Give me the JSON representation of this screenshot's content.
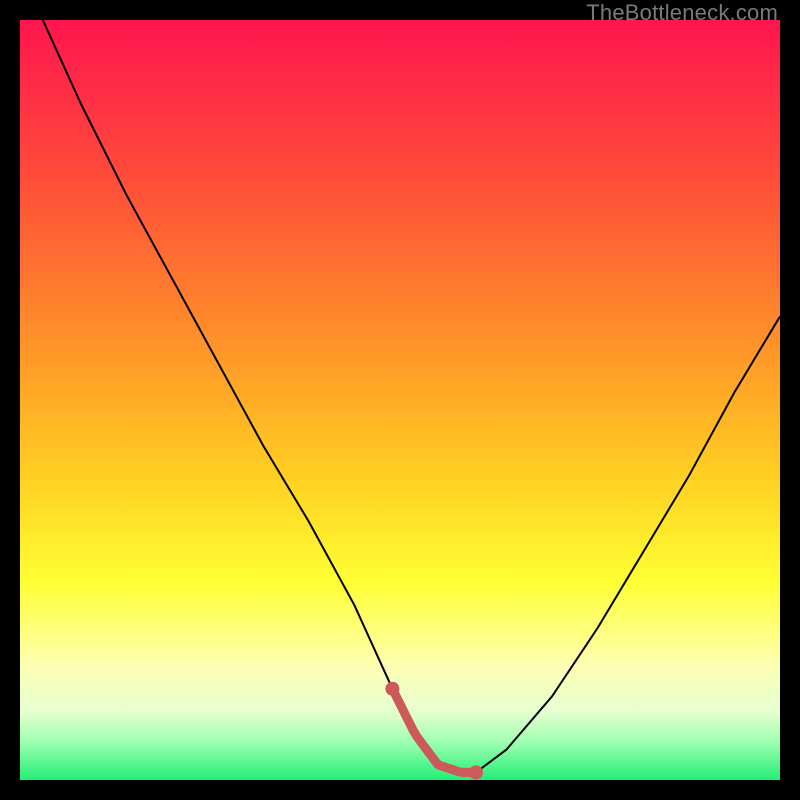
{
  "watermark": {
    "text": "TheBottleneck.com"
  },
  "colors": {
    "black": "#000000",
    "curve": "#000000",
    "accent": "#cc5a5a",
    "gradient_stops": [
      {
        "offset": 0.0,
        "color": "#ff154f"
      },
      {
        "offset": 0.2,
        "color": "#ff4a3a"
      },
      {
        "offset": 0.4,
        "color": "#ff8a2a"
      },
      {
        "offset": 0.6,
        "color": "#ffcf22"
      },
      {
        "offset": 0.74,
        "color": "#ffff33"
      },
      {
        "offset": 0.85,
        "color": "#fdffb3"
      },
      {
        "offset": 0.91,
        "color": "#e6ffd0"
      },
      {
        "offset": 0.95,
        "color": "#9dffb0"
      },
      {
        "offset": 1.0,
        "color": "#22ee77"
      }
    ]
  },
  "chart_data": {
    "type": "line",
    "title": "",
    "xlabel": "",
    "ylabel": "",
    "xlim": [
      0,
      100
    ],
    "ylim": [
      0,
      100
    ],
    "note": "Axes are implicit (no ticks/labels shown). Values are estimated from pixel positions: x is normalized 0–100 across the plot width, y is bottleneck % (0 = bottom/green).",
    "series": [
      {
        "name": "bottleneck-curve",
        "x": [
          3,
          8,
          14,
          20,
          26,
          32,
          38,
          44,
          49,
          52,
          55,
          58,
          60,
          64,
          70,
          76,
          82,
          88,
          94,
          100
        ],
        "y": [
          100,
          89,
          77,
          66,
          55,
          44,
          34,
          23,
          12,
          6,
          2,
          1,
          1,
          4,
          11,
          20,
          30,
          40,
          51,
          61
        ]
      }
    ],
    "optimal_range_x": [
      49,
      60
    ],
    "accent_points_x": [
      49,
      51.5,
      53,
      54.5,
      56,
      57.5,
      59,
      60
    ]
  }
}
